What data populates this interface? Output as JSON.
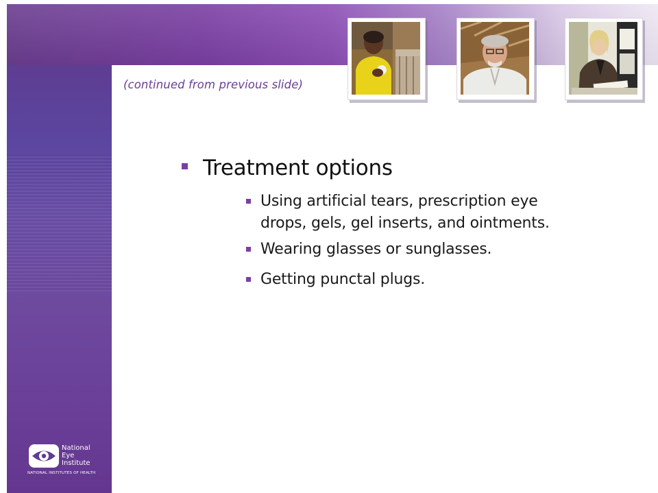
{
  "slide": {
    "continued_note": "(continued from previous slide)",
    "heading": "Treatment options",
    "sub_bullets": [
      {
        "line1": "Using artificial tears, prescription eye",
        "line2": "drops, gels, gel inserts, and ointments."
      },
      {
        "line1": "Wearing glasses or sunglasses."
      },
      {
        "line1": "Getting punctal plugs."
      }
    ]
  },
  "logo": {
    "line1": "National",
    "line2": "Eye",
    "line3": "Institute",
    "subtitle": "NATIONAL INSTITUTES OF HEALTH"
  },
  "photos": [
    {
      "icon": "photo-woman-smiling-icon"
    },
    {
      "icon": "photo-older-man-glasses-icon"
    },
    {
      "icon": "photo-woman-reading-icon"
    }
  ],
  "colors": {
    "accent": "#7a3fa3",
    "band_dark": "#5e3d92",
    "text": "#111111"
  }
}
